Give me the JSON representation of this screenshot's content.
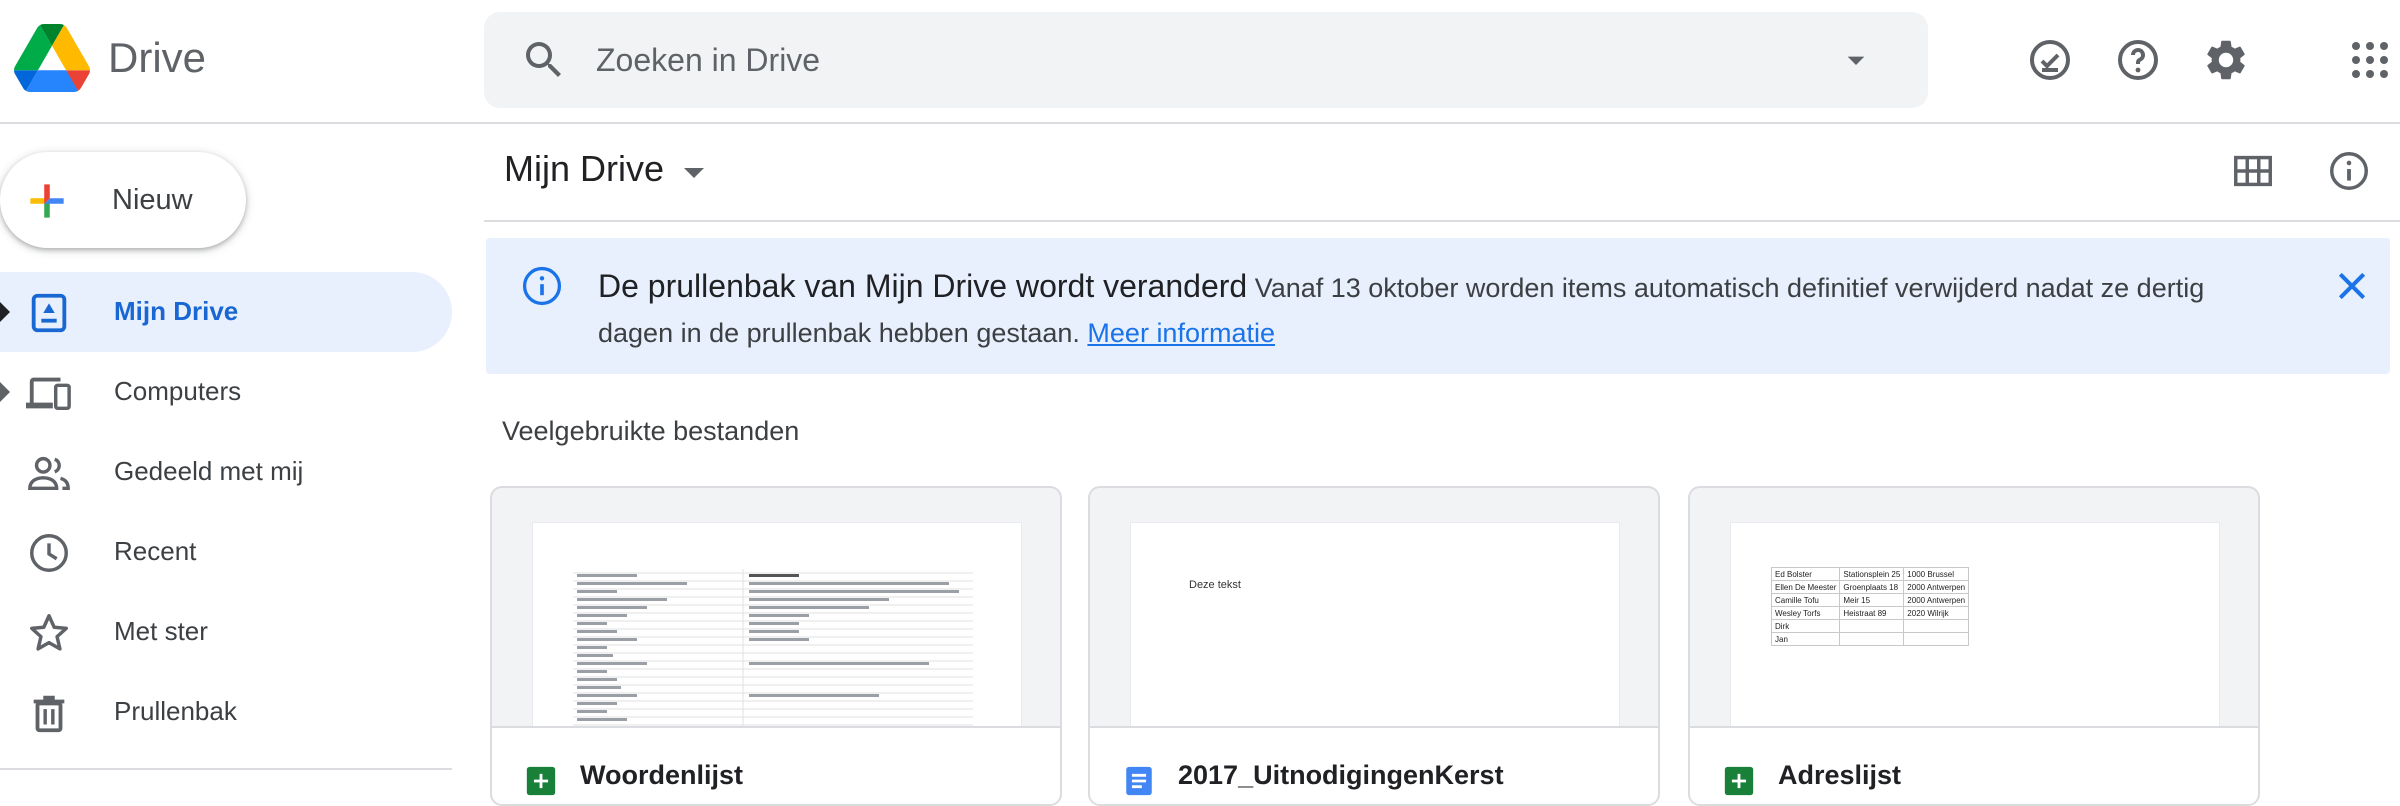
{
  "header": {
    "app_name": "Drive",
    "search_placeholder": "Zoeken in Drive",
    "icons": [
      "ready-for-offline-icon",
      "help-icon",
      "settings-icon",
      "apps-grid-icon"
    ]
  },
  "sidebar": {
    "new_label": "Nieuw",
    "items": [
      {
        "label": "Mijn Drive",
        "icon": "my-drive-icon",
        "active": true
      },
      {
        "label": "Computers",
        "icon": "computers-icon",
        "active": false
      },
      {
        "label": "Gedeeld met mij",
        "icon": "shared-icon",
        "active": false
      },
      {
        "label": "Recent",
        "icon": "clock-icon",
        "active": false
      },
      {
        "label": "Met ster",
        "icon": "star-icon",
        "active": false
      },
      {
        "label": "Prullenbak",
        "icon": "trash-icon",
        "active": false
      }
    ]
  },
  "main": {
    "title": "Mijn Drive",
    "banner": {
      "title": "De prullenbak van Mijn Drive wordt veranderd",
      "body": "Vanaf 13 oktober worden items automatisch definitief verwijderd nadat ze dertig dagen in de prullenbak hebben gestaan.",
      "link": "Meer informatie"
    },
    "section_title": "Veelgebruikte bestanden",
    "files": [
      {
        "name": "Woordenlijst",
        "type": "sheets"
      },
      {
        "name": "2017_UitnodigingenKerst",
        "type": "docs",
        "preview_text": "Deze  tekst"
      },
      {
        "name": "Adreslijst",
        "type": "sheets",
        "preview_rows": [
          [
            "Ed Bolster",
            "Stationsplein 25",
            "1000 Brussel"
          ],
          [
            "Ellen De Meester",
            "Groenplaats 18",
            "2000 Antwerpen"
          ],
          [
            "Camille Tofu",
            "Meir 15",
            "2000 Antwerpen"
          ],
          [
            "Wesley Torfs",
            "Heistraat 89",
            "2020 Wilrijk"
          ],
          [
            "Dirk",
            "",
            ""
          ],
          [
            "Jan",
            "",
            ""
          ]
        ]
      }
    ]
  },
  "colors": {
    "accent": "#1a73e8",
    "active_bg": "#e8f0fe",
    "sheets_green": "#188038",
    "docs_blue": "#4285f4"
  }
}
